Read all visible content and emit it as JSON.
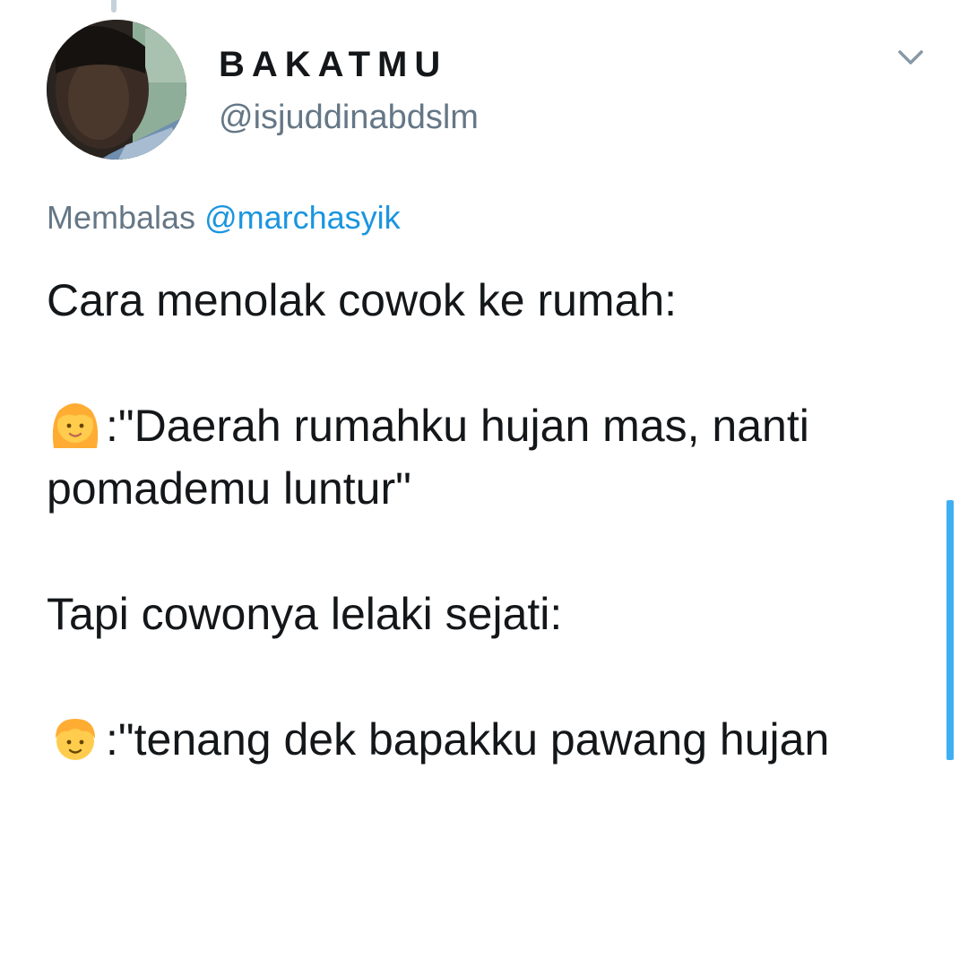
{
  "tweet": {
    "display_name": "BAKATMU",
    "handle": "@isjuddinabdslm",
    "reply_prefix": "Membalas",
    "reply_mention": "@marchasyik",
    "lines": {
      "intro": "Cara menolak cowok ke rumah:",
      "girl_quote": ":\"Daerah rumahku hujan mas, nanti pomademu luntur\"",
      "transition": "Tapi cowonya lelaki sejati:",
      "boy_quote": ":\"tenang dek bapakku pawang hujan"
    },
    "emojis": {
      "girl": "girl-emoji",
      "boy": "boy-emoji"
    },
    "icons": {
      "menu": "chevron-down-icon"
    }
  },
  "colors": {
    "text": "#14171a",
    "secondary": "#657786",
    "link": "#1b95e0",
    "scroll_indicator": "#1da1f2",
    "emoji_skin": "#ffcc4d",
    "emoji_hair": "#ffac33"
  }
}
